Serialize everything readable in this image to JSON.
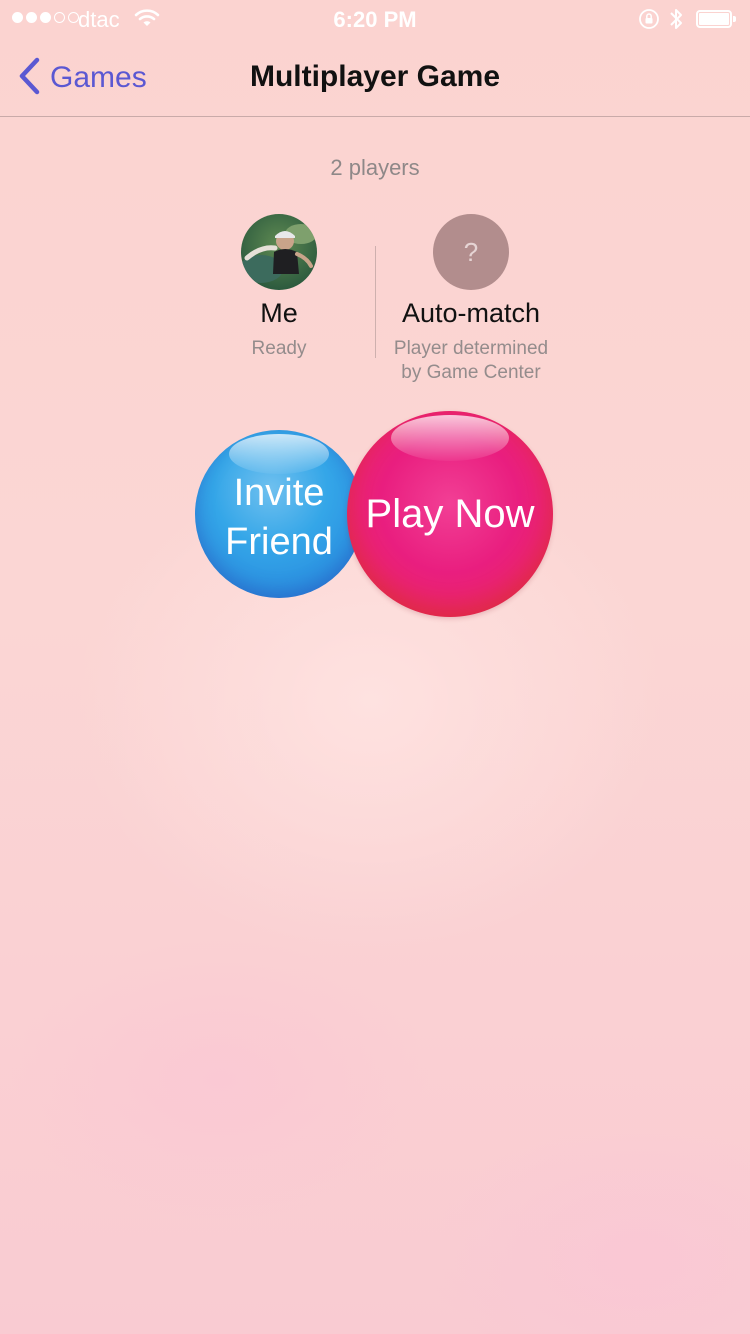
{
  "status_bar": {
    "signal_bars": [
      true,
      true,
      true,
      false,
      false
    ],
    "carrier": "dtac",
    "time": "6:20 PM",
    "icons": [
      "wifi-icon",
      "orientation-lock-icon",
      "bluetooth-icon",
      "battery-icon"
    ],
    "battery_level": 1.0
  },
  "nav": {
    "back_label": "Games",
    "title": "Multiplayer Game",
    "accent_color": "#5b58d2"
  },
  "players_count": "2 players",
  "players": [
    {
      "name": "Me",
      "status": "Ready",
      "avatar": "user-photo"
    },
    {
      "name": "Auto-match",
      "status": "Player determined by Game Center",
      "avatar_glyph": "?"
    }
  ],
  "actions": {
    "invite_label": "Invite Friend",
    "play_label": "Play Now"
  },
  "colors": {
    "invite_bubble": "#34a6e8",
    "play_bubble": "#e91e7f",
    "background": "#fbd6d4"
  }
}
